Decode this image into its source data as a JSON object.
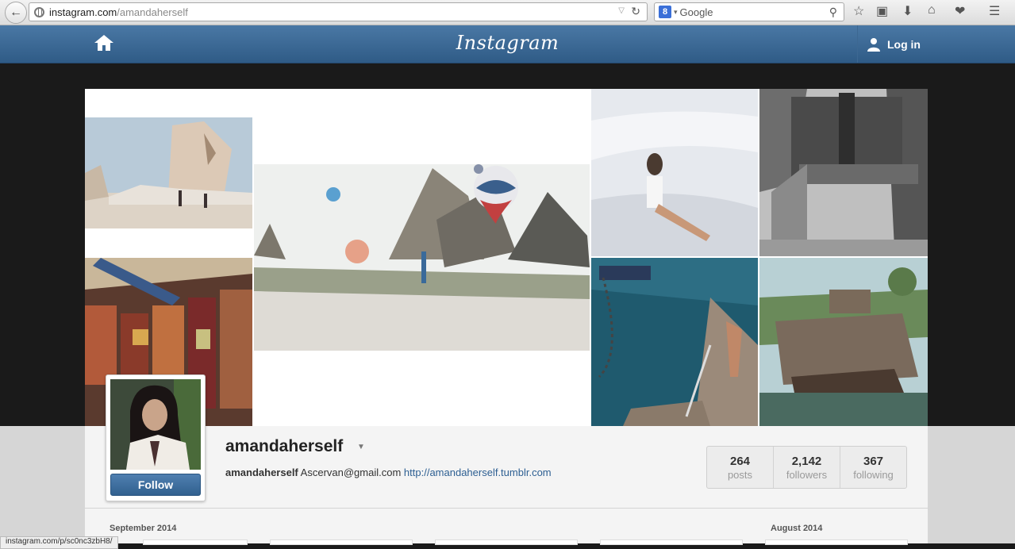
{
  "browser": {
    "url_host": "instagram.com",
    "url_path": "/amandaherself",
    "search_engine_letter": "8",
    "search_placeholder": "Google"
  },
  "header": {
    "logo": "Instagram",
    "login_label": "Log in"
  },
  "profile": {
    "username": "amandaherself",
    "bio_name": "amandaherself",
    "bio_text": "Ascervan@gmail.com",
    "bio_link": "http://amandaherself.tumblr.com",
    "follow_label": "Follow",
    "stats": [
      {
        "value": "264",
        "label": "posts"
      },
      {
        "value": "2,142",
        "label": "followers"
      },
      {
        "value": "367",
        "label": "following"
      }
    ]
  },
  "timeline": {
    "month_left": "September 2014",
    "month_right": "August 2014"
  },
  "status_bar": {
    "hover_url": "instagram.com/p/sc0nc3zbH8/"
  },
  "colors": {
    "header_blue": "#3b6a96",
    "link_blue": "#2d5f92"
  }
}
